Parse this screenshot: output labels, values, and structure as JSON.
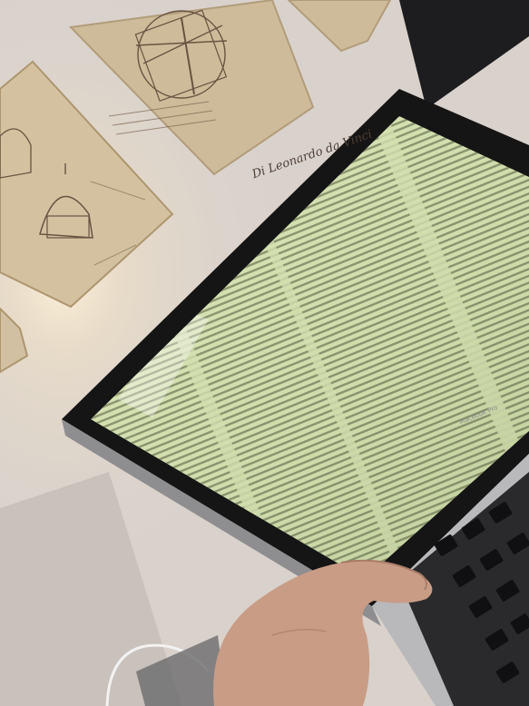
{
  "scene": {
    "poster_signature": "Di Leonardo da Vinci",
    "laptop_badge": "MacBook Pro"
  },
  "colors": {
    "wall": "#d9d2cc",
    "paper": "#cdbb9a",
    "sketch_ink": "#6a5342",
    "screen": "#ccd9a8",
    "terminal_text": "#4a4e33",
    "laptop_shell": "#b9b9bb",
    "bezel": "#151515",
    "skin": "#c99c86"
  }
}
